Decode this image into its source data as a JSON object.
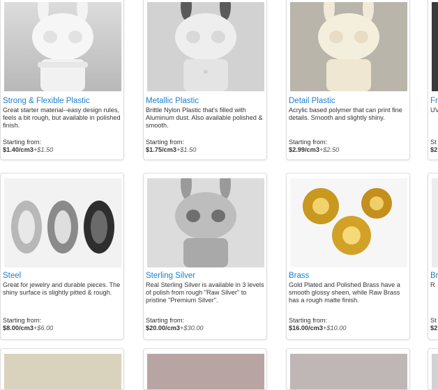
{
  "materials": [
    {
      "title": "Strong & Flexible Plastic",
      "desc": "Great starter material--easy design rules, feels a bit rough, but available in polished finish.",
      "from": "Starting from:",
      "price": "$1.40/cm3",
      "plus": "+$1.50"
    },
    {
      "title": "Metallic Plastic",
      "desc": "Brittle Nylon Plastic that's filled with Aluminum dust. Also available polished & smooth.",
      "from": "Starting from:",
      "price": "$1.75/cm3",
      "plus": "+$1.50"
    },
    {
      "title": "Detail Plastic",
      "desc": "Acrylic based polymer that can print fine details. Smooth and slightly shiny.",
      "from": "Starting from:",
      "price": "$2.99/cm3",
      "plus": "+$2.50"
    },
    {
      "title": "Fr",
      "desc": "UV",
      "from": "St",
      "price": "$2",
      "plus": ""
    },
    {
      "title": "Steel",
      "desc": "Great for jewelry and durable pieces. The shiny surface is slightly pitted & rough.",
      "from": "Starting from:",
      "price": "$8.00/cm3",
      "plus": "+$6.00"
    },
    {
      "title": "Sterling Silver",
      "desc": "Real Sterling Silver is available in 3 levels of polish from rough \"Raw Silver\" to pristine \"Premium Silver\".",
      "from": "Starting from:",
      "price": "$20.00/cm3",
      "plus": "+$30.00"
    },
    {
      "title": "Brass",
      "desc": "Gold Plated and Polished Brass have a smooth glossy sheen, while Raw Brass has a rough matte finish.",
      "from": "Starting from:",
      "price": "$16.00/cm3",
      "plus": "+$10.00"
    },
    {
      "title": "Br",
      "desc": "R",
      "from": "St",
      "price": "$2",
      "plus": ""
    }
  ]
}
